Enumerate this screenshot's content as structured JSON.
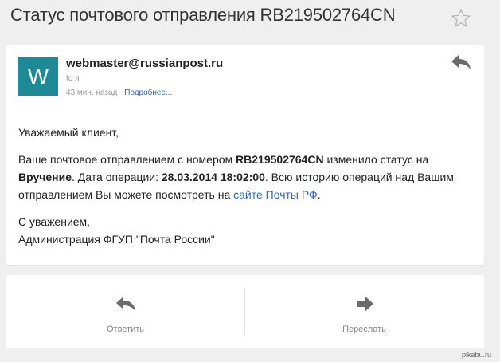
{
  "subject": "Статус почтового отправления RB219502764CN",
  "message": {
    "avatar_letter": "W",
    "sender": "webmaster@russianpost.ru",
    "to": "to я",
    "time": "43 мин. назад",
    "details_link": "Подробнее...",
    "greeting": "Уважаемый клиент,",
    "p1": "Ваше почтовое отправлением с номером ",
    "tracking": "RB219502764CN",
    "p2": " изменило статус на ",
    "status": "Вручение",
    "p3": ". Дата операции: ",
    "date": "28.03.2014 18:02:00",
    "p4": ". Всю историю операций над Вашим отправлением Вы можете посмотреть на ",
    "site_link": "сайте Почты РФ",
    "p5": ".",
    "regards": "С уважением,",
    "signature": "Администрация ФГУП \"Почта России\""
  },
  "actions": {
    "reply_label": "Ответить",
    "forward_label": "Переслать"
  },
  "watermark": "pikabu.ru",
  "colors": {
    "avatar": "#1e8a98",
    "link": "#3367b3",
    "background": "#efefef"
  },
  "icons": [
    "star-icon",
    "reply-icon",
    "forward-icon"
  ]
}
